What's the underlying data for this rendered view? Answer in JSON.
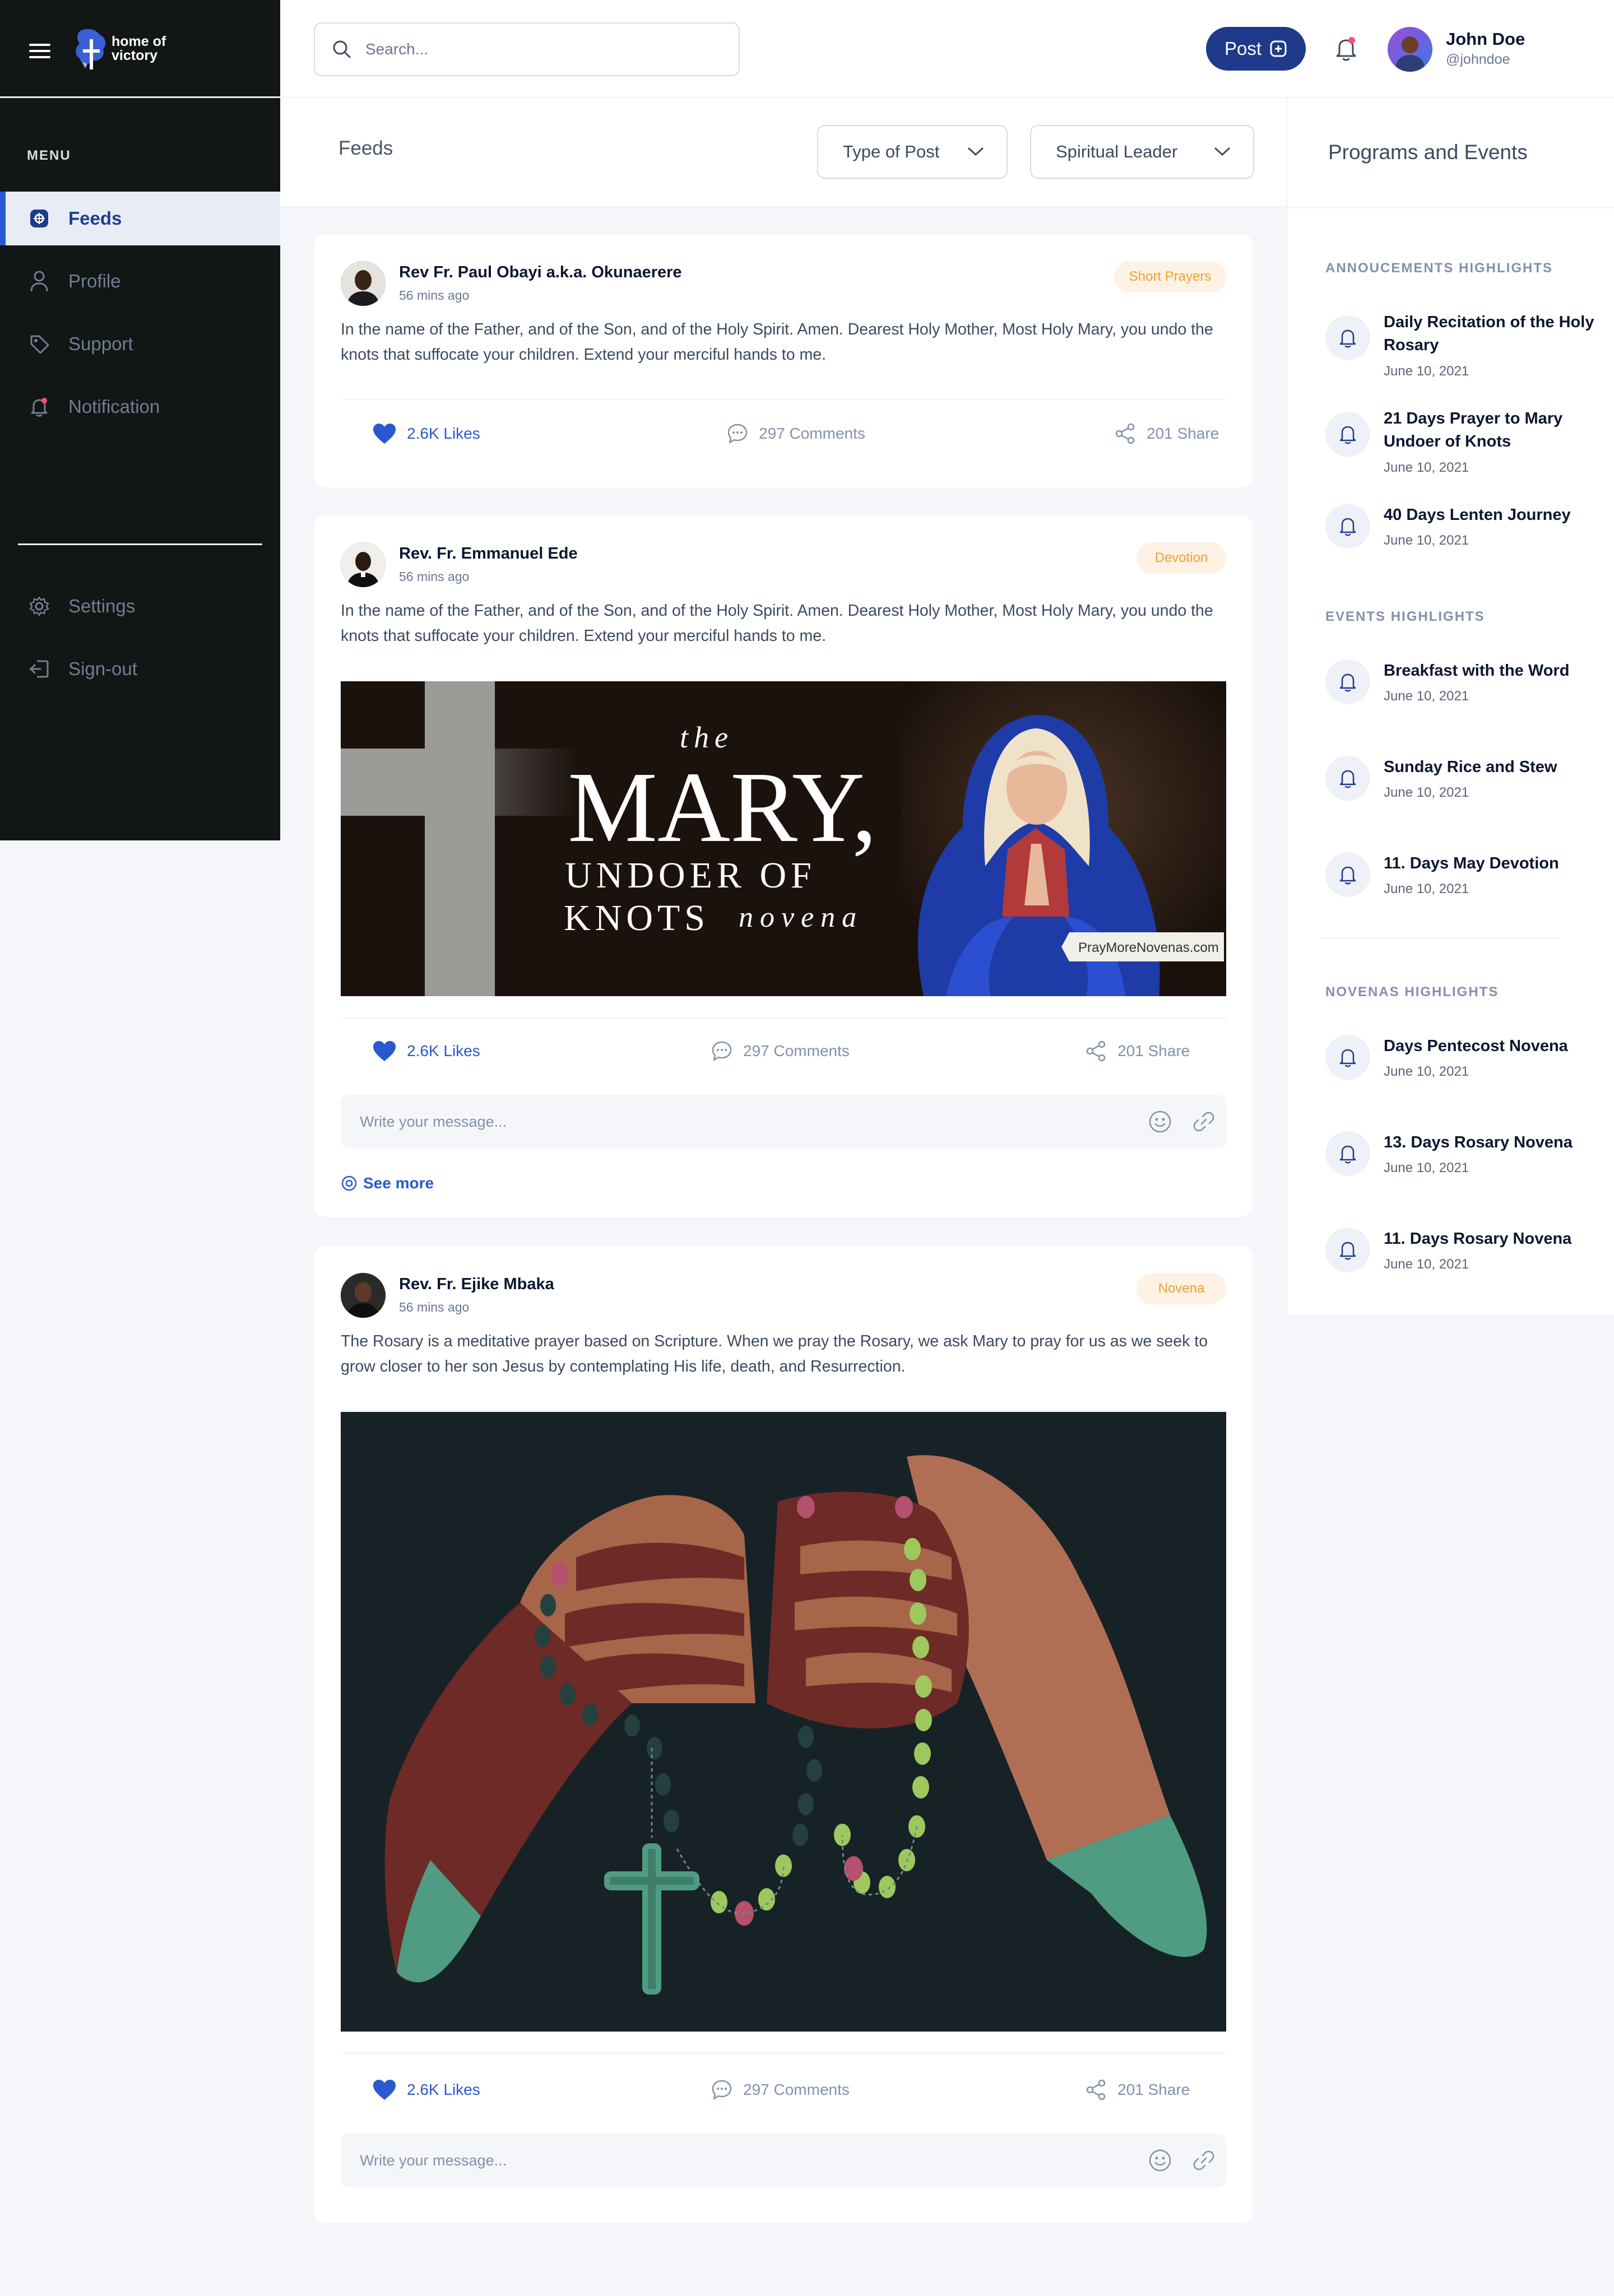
{
  "app": {
    "logo_text": "home of victory"
  },
  "sidebar": {
    "menu_label": "MENU",
    "items": [
      {
        "label": "Feeds",
        "icon": "feeds-icon",
        "active": true
      },
      {
        "label": "Profile",
        "icon": "user-icon"
      },
      {
        "label": "Support",
        "icon": "tag-icon"
      },
      {
        "label": "Notification",
        "icon": "bell-icon"
      }
    ],
    "bottom_items": [
      {
        "label": "Settings",
        "icon": "gear-icon"
      },
      {
        "label": "Sign-out",
        "icon": "sign-out-icon"
      }
    ]
  },
  "header": {
    "search_placeholder": "Search...",
    "post_label": "Post",
    "user": {
      "name": "John Doe",
      "handle": "@johndoe"
    }
  },
  "feeds": {
    "title": "Feeds",
    "filters": [
      "Type of Post",
      "Spiritual Leader"
    ]
  },
  "posts": [
    {
      "author": "Rev Fr. Paul Obayi a.k.a. Okunaerere",
      "time": "56 mins ago",
      "tag": "Short Prayers",
      "text": "In the name of the Father, and of the Son, and of the Holy Spirit. Amen. Dearest Holy Mother, Most Holy Mary, you undo the knots that suffocate your children. Extend your merciful hands to me.",
      "likes": "2.6K Likes",
      "comments": "297 Comments",
      "shares": "201 Share"
    },
    {
      "author": "Rev. Fr. Emmanuel Ede",
      "time": "56 mins ago",
      "tag": "Devotion",
      "text": "In the name of the Father, and of the Son, and of the Holy Spirit. Amen. Dearest Holy Mother, Most Holy Mary, you undo the knots that suffocate your children. Extend your merciful hands to me.",
      "image": {
        "line1": "the",
        "line2": "MARY,",
        "line3": "UNDOER OF",
        "line4": "KNOTS",
        "line5": "novena",
        "credit": "PrayMoreNovenas.com"
      },
      "likes": "2.6K Likes",
      "comments": "297 Comments",
      "shares": "201 Share",
      "message_placeholder": "Write your message...",
      "see_more": "See more"
    },
    {
      "author": "Rev. Fr. Ejike Mbaka",
      "time": "56 mins ago",
      "tag": "Novena",
      "text": "The Rosary is a meditative prayer based on Scripture. When we pray the Rosary, we ask Mary to pray for us as we seek to grow closer to her son Jesus by contemplating His life, death, and Resurrection.",
      "likes": "2.6K Likes",
      "comments": "297 Comments",
      "shares": "201 Share",
      "message_placeholder": "Write your message..."
    }
  ],
  "programs": {
    "title": "Programs and Events",
    "sections": [
      {
        "label": "ANNOUCEMENTS  HIGHLIGHTS",
        "items": [
          {
            "title": "Daily Recitation of the Holy Rosary",
            "date": "June 10, 2021"
          },
          {
            "title": "21 Days Prayer to Mary Undoer of Knots",
            "date": "June 10, 2021"
          },
          {
            "title": "40 Days Lenten Journey",
            "date": "June 10, 2021"
          }
        ]
      },
      {
        "label": "EVENTS  HIGHLIGHTS",
        "items": [
          {
            "title": "Breakfast with the Word",
            "date": "June 10, 2021"
          },
          {
            "title": "Sunday Rice and Stew",
            "date": "June 10, 2021"
          },
          {
            "title": "11. Days May Devotion",
            "date": "June 10, 2021"
          }
        ]
      },
      {
        "label": "NOVENAS  HIGHLIGHTS",
        "items": [
          {
            "title": "Days Pentecost Novena",
            "date": "June 10, 2021"
          },
          {
            "title": "13. Days Rosary Novena",
            "date": "June 10, 2021"
          },
          {
            "title": "11. Days Rosary Novena",
            "date": "June 10, 2021"
          }
        ]
      }
    ]
  },
  "colors": {
    "sidebar_bg": "#121614",
    "accent": "#2a58d0",
    "post_button": "#1f3a8a",
    "tag_text": "#f0a030",
    "tag_bg": "#fdf2e4"
  }
}
